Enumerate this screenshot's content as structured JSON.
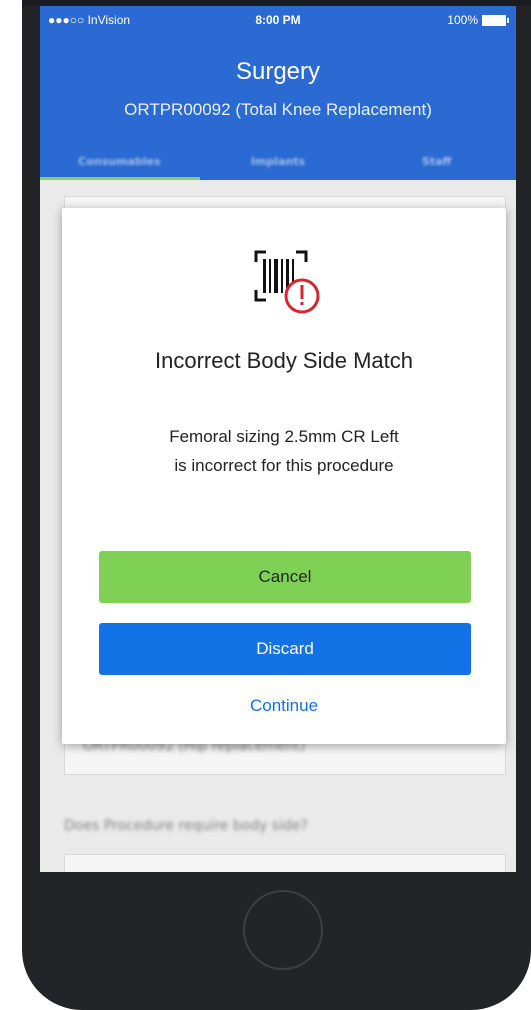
{
  "status_bar": {
    "carrier": "●●●○○ InVision",
    "time": "8:00 PM",
    "battery": "100%"
  },
  "header": {
    "title": "Surgery",
    "subtitle": "ORTPR00092 (Total Knee Replacement)"
  },
  "tabs": [
    {
      "label": "Consumables",
      "active": true
    },
    {
      "label": "Implants",
      "active": false
    },
    {
      "label": "Staff",
      "active": false
    }
  ],
  "background": {
    "field_value": "ORTPR00092 (Hip replacement)",
    "question": "Does Procedure require body side?"
  },
  "modal": {
    "icon": "barcode-alert-icon",
    "title": "Incorrect Body Side Match",
    "message_line1": "Femoral sizing 2.5mm CR Left",
    "message_line2": "is incorrect for this procedure",
    "cancel_label": "Cancel",
    "discard_label": "Discard",
    "continue_label": "Continue"
  },
  "colors": {
    "header_blue": "#2a6ad2",
    "cancel_green": "#7ed155",
    "discard_blue": "#1273e6",
    "alert_red": "#d9262e"
  }
}
